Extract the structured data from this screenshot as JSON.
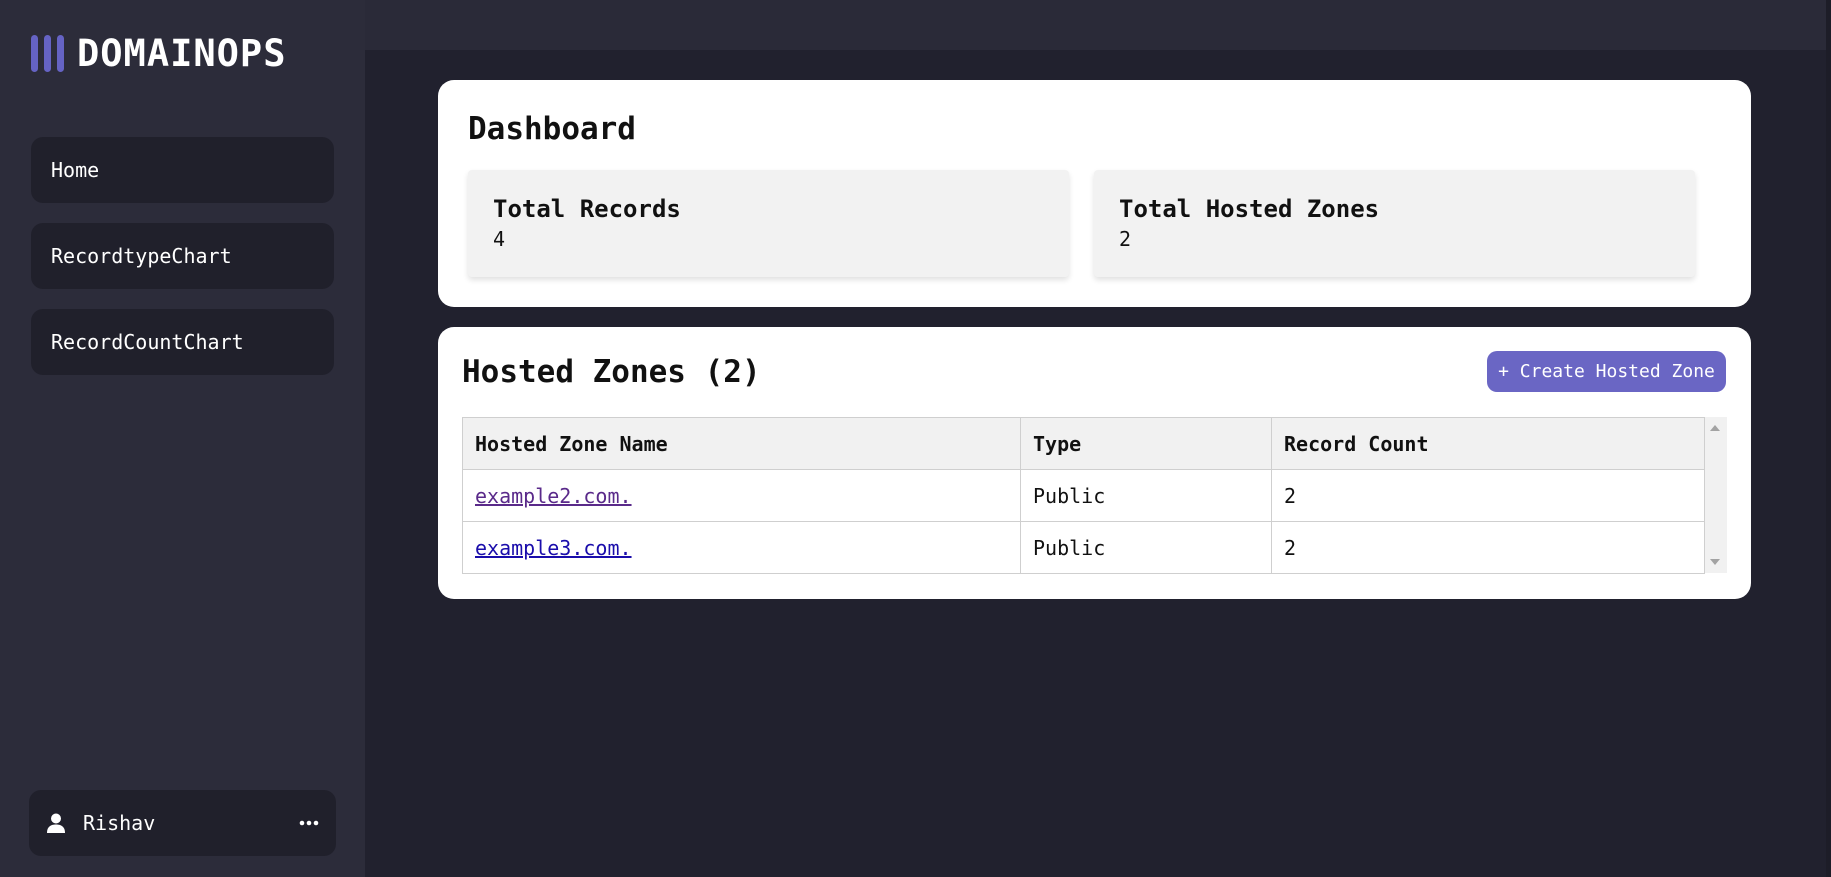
{
  "brand": {
    "name": "DOMAINOPS",
    "accent": "#6563c4"
  },
  "sidebar": {
    "items": [
      {
        "label": "Home"
      },
      {
        "label": "RecordtypeChart"
      },
      {
        "label": "RecordCountChart"
      }
    ],
    "user": {
      "name": "Rishav",
      "icon": "user-icon",
      "menu_icon": "more-dots-icon"
    }
  },
  "dashboard": {
    "title": "Dashboard",
    "stats": [
      {
        "label": "Total Records",
        "value": "4"
      },
      {
        "label": "Total Hosted Zones",
        "value": "2"
      }
    ]
  },
  "hosted_zones": {
    "title": "Hosted Zones (2)",
    "create_label": "+ Create Hosted Zone",
    "columns": [
      "Hosted Zone Name",
      "Type",
      "Record Count"
    ],
    "rows": [
      {
        "name": "example2.com.",
        "type": "Public",
        "count": "2"
      },
      {
        "name": "example3.com.",
        "type": "Public",
        "count": "2"
      }
    ]
  }
}
